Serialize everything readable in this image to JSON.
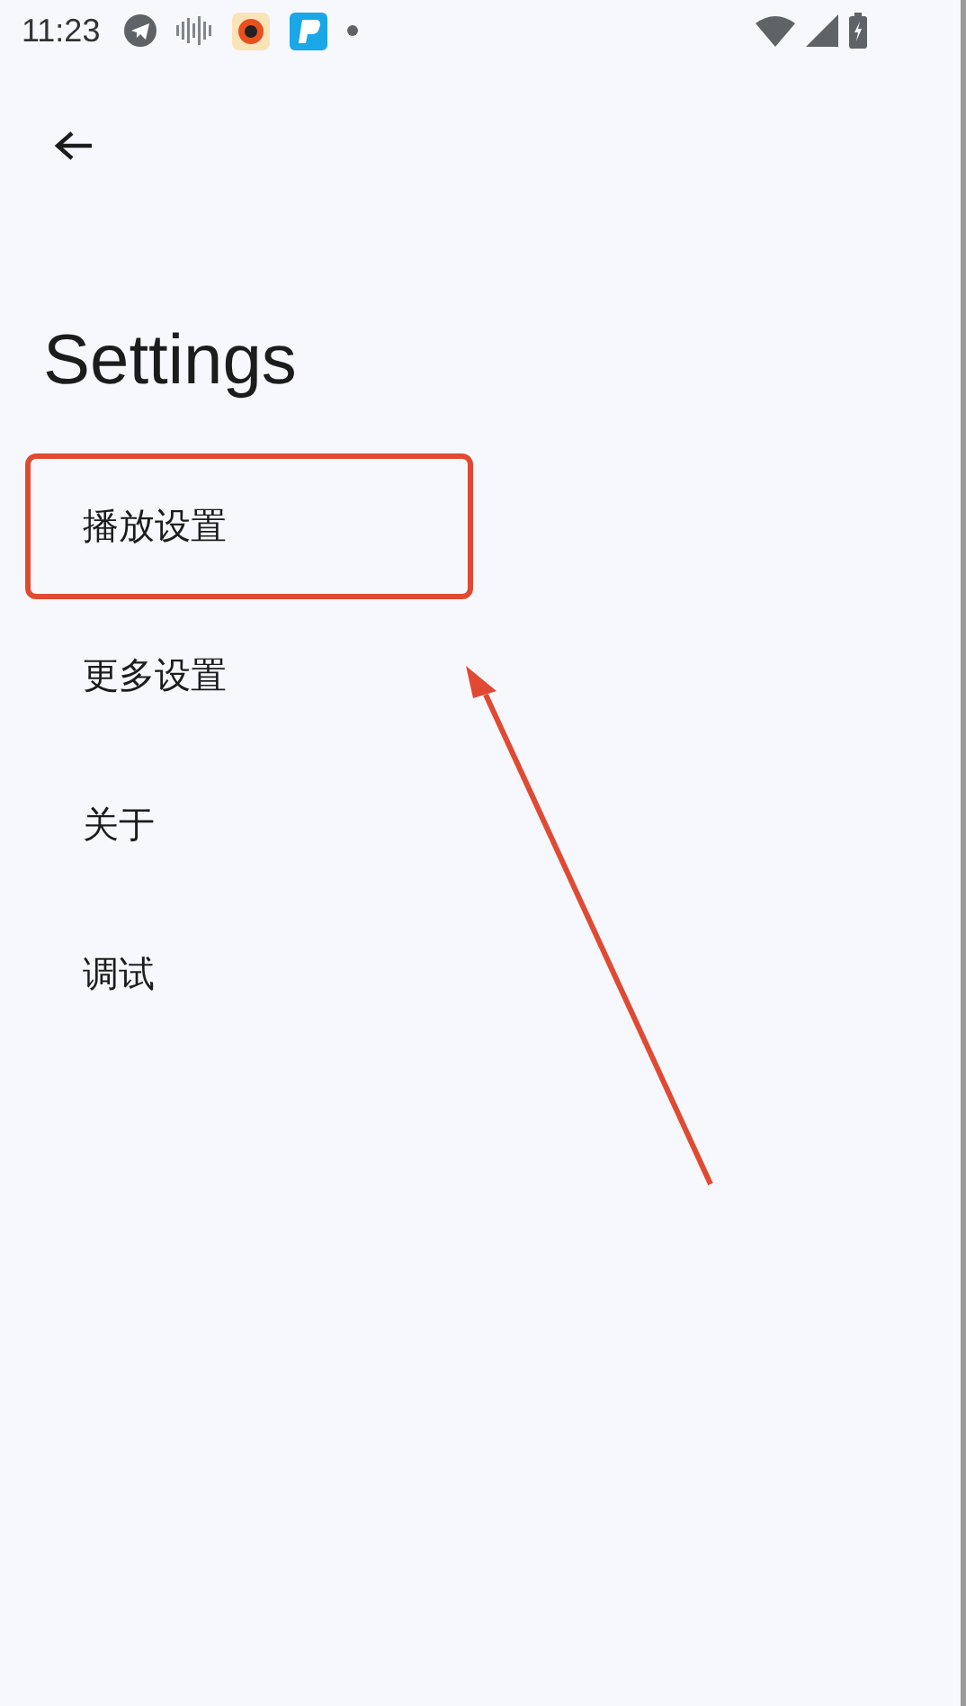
{
  "status_bar": {
    "time": "11:23",
    "notification_icons": [
      {
        "kind": "telegram"
      },
      {
        "kind": "waveform"
      },
      {
        "kind": "app_orange"
      },
      {
        "kind": "app_blue"
      },
      {
        "kind": "dot"
      }
    ]
  },
  "app_bar": {
    "back": true
  },
  "title": "Settings",
  "items": [
    {
      "label": "播放设置",
      "highlighted": true
    },
    {
      "label": "更多设置",
      "highlighted": false
    },
    {
      "label": "关于",
      "highlighted": false
    },
    {
      "label": "调试",
      "highlighted": false
    }
  ],
  "annotation_arrow": true
}
